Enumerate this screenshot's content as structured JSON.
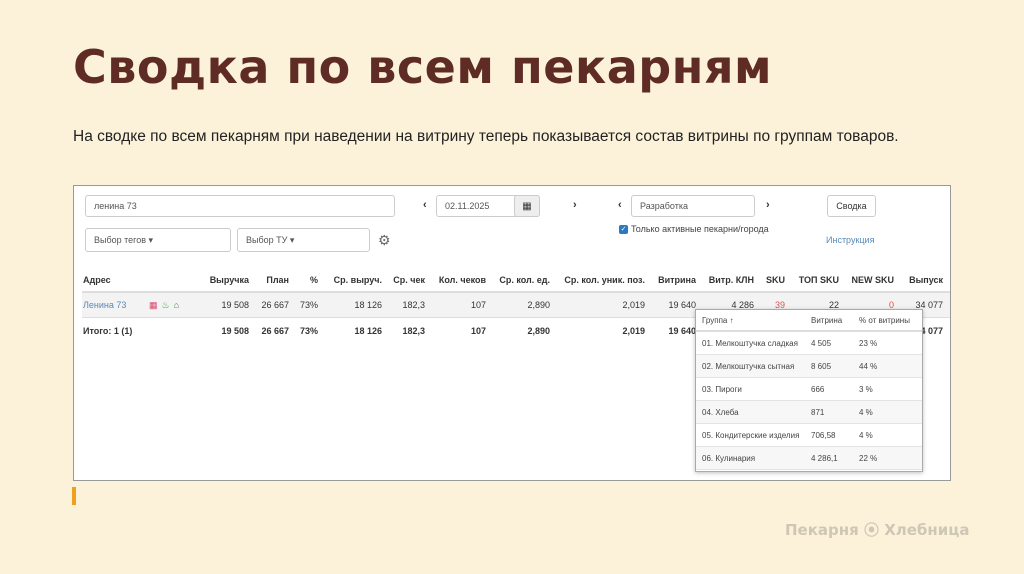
{
  "slide": {
    "title": "Сводка по всем пекарням",
    "description": "На сводке по всем пекарням при наведении на витрину теперь показывается состав витрины по группам товаров.",
    "logo": "Пекарня ⦿ Хлебница"
  },
  "filters": {
    "search": "ленина 73",
    "date": "02.11.2025",
    "env": "Разработка",
    "summary_button": "Сводка",
    "tags": "Выбор тегов ▾",
    "tu": "Выбор ТУ ▾",
    "active_only": "Только активные пекарни/города",
    "instruction": "Инструкция"
  },
  "table": {
    "headers": [
      "Адрес",
      "Выручка",
      "План",
      "%",
      "Ср. выруч.",
      "Ср. чек",
      "Кол. чеков",
      "Ср. кол. ед.",
      "Ср. кол. уник. поз.",
      "Витрина",
      "Витр. КЛН",
      "SKU",
      "ТОП SKU",
      "NEW SKU",
      "Выпуск"
    ],
    "row": [
      "Ленина 73",
      "19 508",
      "26 667",
      "73%",
      "18 126",
      "182,3",
      "107",
      "2,890",
      "2,019",
      "19 640",
      "4 286",
      "39",
      "22",
      "0",
      "34 077"
    ],
    "total": [
      "Итого: 1 (1)",
      "19 508",
      "26 667",
      "73%",
      "18 126",
      "182,3",
      "107",
      "2,890",
      "2,019",
      "19 640",
      "",
      "",
      "",
      "",
      "34 077"
    ]
  },
  "popup": {
    "headers": [
      "Группа ↑",
      "Витрина",
      "% от витрины"
    ],
    "rows": [
      [
        "01. Мелкоштучка сладкая",
        "4 505",
        "23 %"
      ],
      [
        "02. Мелкоштучка сытная",
        "8 605",
        "44 %"
      ],
      [
        "03. Пироги",
        "666",
        "3 %"
      ],
      [
        "04. Хлеба",
        "871",
        "4 %"
      ],
      [
        "05. Кондитерские изделия",
        "706,58",
        "4 %"
      ],
      [
        "06. Кулинария",
        "4 286,1",
        "22 %"
      ]
    ]
  },
  "colors": {
    "title": "#5e2c25",
    "link": "#3a7ab8",
    "alert": "#d9534f"
  }
}
